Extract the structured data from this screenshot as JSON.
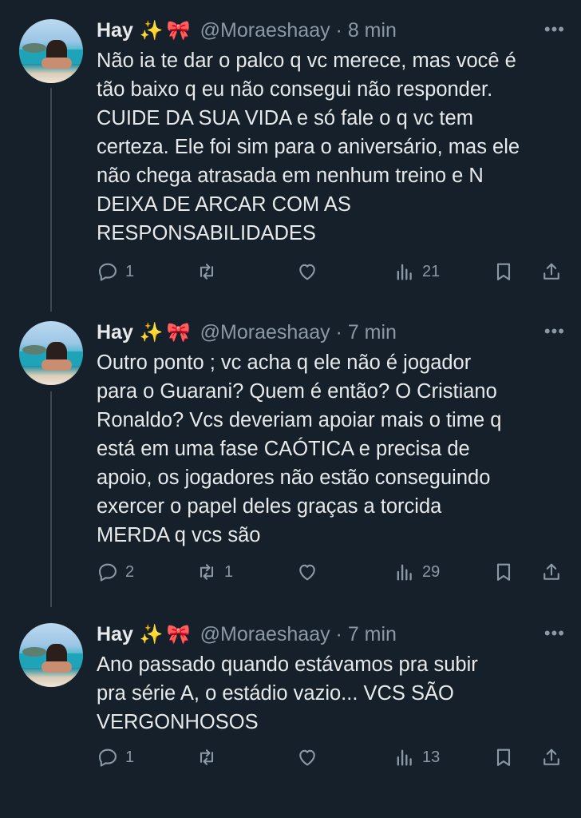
{
  "tweets": [
    {
      "name": "Hay",
      "emoji_sparkle": "✨",
      "emoji_bow": "🎀",
      "handle_time": "@Moraeshaay · 8 min",
      "lines": [
        "Não ia te dar o palco q vc merece, mas você é",
        "tão baixo q eu não consegui não responder.",
        "CUIDE DA SUA VIDA e só fale o q vc tem",
        "certeza. Ele foi sim para o aniversário, mas ele",
        "não chega atrasada em nenhum treino e N",
        "DEIXA DE ARCAR COM AS",
        "RESPONSABILIDADES"
      ],
      "replies": "1",
      "retweets": "",
      "likes": "",
      "views": "21"
    },
    {
      "name": "Hay",
      "emoji_sparkle": "✨",
      "emoji_bow": "🎀",
      "handle_time": "@Moraeshaay · 7 min",
      "lines": [
        "Outro ponto ; vc acha q ele não é jogador",
        "para o Guarani? Quem é então? O Cristiano",
        "Ronaldo? Vcs deveriam apoiar mais o time q",
        "está em uma fase CAÓTICA e precisa de",
        "apoio, os jogadores não estão conseguindo",
        "exercer o papel deles graças a torcida",
        "MERDA q vcs são"
      ],
      "replies": "2",
      "retweets": "1",
      "likes": "",
      "views": "29"
    },
    {
      "name": "Hay",
      "emoji_sparkle": "✨",
      "emoji_bow": "🎀",
      "handle_time": "@Moraeshaay · 7 min",
      "lines": [
        "Ano passado quando estávamos pra subir",
        "pra série A, o estádio vazio... VCS SÃO",
        "VERGONHOSOS"
      ],
      "replies": "1",
      "retweets": "",
      "likes": "",
      "views": "13"
    }
  ],
  "icons": {
    "more": "more-icon",
    "reply": "reply-icon",
    "retweet": "retweet-icon",
    "like": "heart-icon",
    "views": "views-icon",
    "bookmark": "bookmark-icon",
    "share": "share-icon"
  },
  "colors": {
    "background": "#15202b",
    "text": "#e7e9ea",
    "secondary": "#8b98a5"
  }
}
